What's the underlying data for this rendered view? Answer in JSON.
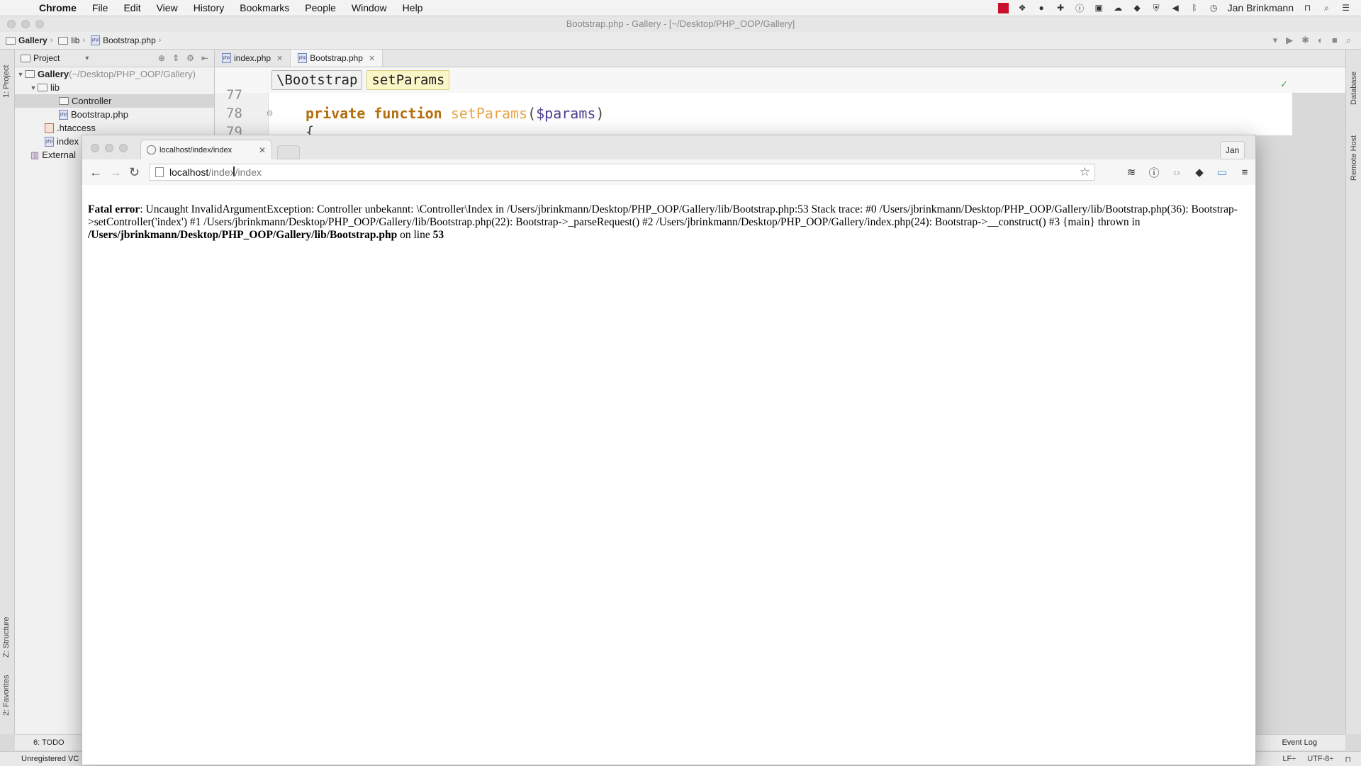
{
  "menubar": {
    "app": "Chrome",
    "items": [
      "File",
      "Edit",
      "View",
      "History",
      "Bookmarks",
      "People",
      "Window",
      "Help"
    ],
    "user": "Jan Brinkmann"
  },
  "ide": {
    "window_title": "Bootstrap.php - Gallery - [~/Desktop/PHP_OOP/Gallery]",
    "nav": {
      "crumb1": "Gallery",
      "crumb2": "lib",
      "crumb3": "Bootstrap.php"
    },
    "project": {
      "header": "Project",
      "rows": [
        {
          "label": "Gallery",
          "muted": " (~/Desktop/PHP_OOP/Gallery)"
        },
        {
          "label": "lib"
        },
        {
          "label": "Controller"
        },
        {
          "label": "Bootstrap.php"
        },
        {
          "label": ".htaccess"
        },
        {
          "label": "index"
        },
        {
          "label": "External"
        }
      ]
    },
    "tabs": [
      {
        "label": "index.php"
      },
      {
        "label": "Bootstrap.php"
      }
    ],
    "chips": [
      "\\Bootstrap",
      "setParams"
    ],
    "code": {
      "line_77": "77",
      "line_78": "78",
      "line_79": "79",
      "kw1": "private",
      "kw2": "function",
      "fn": "setParams",
      "paren_open": "(",
      "var": "$params",
      "paren_close": ")",
      "brace": "{"
    },
    "left_labels": {
      "project": "1: Project",
      "structure": "Z: Structure",
      "favorites": "2: Favorites"
    },
    "right_labels": {
      "database": "Database",
      "remote": "Remote Host"
    },
    "todo": "6: TODO",
    "event_log": "Event Log",
    "status_left": "Unregistered VC",
    "status_right": {
      "lf": "LF÷",
      "enc": "UTF-8÷"
    }
  },
  "chrome": {
    "tab_title": "localhost/index/index",
    "profile": "Jan",
    "url_host": "localhost",
    "url_path": "/index/index",
    "error": {
      "label": "Fatal error",
      "message": ": Uncaught InvalidArgumentException: Controller unbekannt: \\Controller\\Index in /Users/jbrinkmann/Desktop/PHP_OOP/Gallery/lib/Bootstrap.php:53 Stack trace: #0 /Users/jbrinkmann/Desktop/PHP_OOP/Gallery/lib/Bootstrap.php(36): Bootstrap->setController('index') #1 /Users/jbrinkmann/Desktop/PHP_OOP/Gallery/lib/Bootstrap.php(22): Bootstrap->_parseRequest() #2 /Users/jbrinkmann/Desktop/PHP_OOP/Gallery/index.php(24): Bootstrap->__construct() #3 {main} thrown in ",
      "file": "/Users/jbrinkmann/Desktop/PHP_OOP/Gallery/lib/Bootstrap.php",
      "on_line": " on line ",
      "line": "53"
    }
  }
}
